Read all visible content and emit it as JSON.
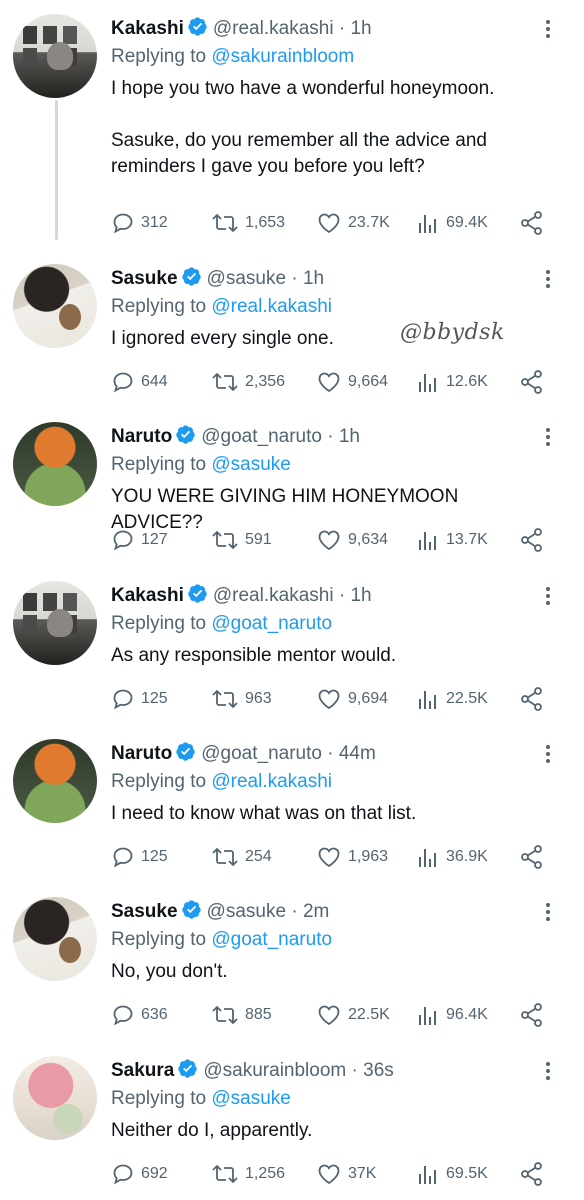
{
  "watermark": "@bbydsk",
  "colors": {
    "link": "#1d9bf0",
    "muted": "#536471",
    "verified": "#1d9bf0"
  },
  "tweets": [
    {
      "name": "Kakashi",
      "handle": "@real.kakashi",
      "sep": "·",
      "time": "1h",
      "replying_label": "Replying to",
      "replying_to": "@sakurainbloom",
      "text": "I hope you two have a wonderful honeymoon.\n\nSasuke, do you remember all the advice and reminders I gave you before you left?",
      "replies": "312",
      "retweets": "1,653",
      "likes": "23.7K",
      "views": "69.4K"
    },
    {
      "name": "Sasuke",
      "handle": "@sasuke",
      "sep": "·",
      "time": "1h",
      "replying_label": "Replying to",
      "replying_to": "@real.kakashi",
      "text": "I ignored every single one.",
      "replies": "644",
      "retweets": "2,356",
      "likes": "9,664",
      "views": "12.6K"
    },
    {
      "name": "Naruto",
      "handle": "@goat_naruto",
      "sep": "·",
      "time": "1h",
      "replying_label": "Replying to",
      "replying_to": "@sasuke",
      "text": "YOU WERE GIVING HIM HONEYMOON ADVICE??",
      "replies": "127",
      "retweets": "591",
      "likes": "9,634",
      "views": "13.7K"
    },
    {
      "name": "Kakashi",
      "handle": "@real.kakashi",
      "sep": "·",
      "time": "1h",
      "replying_label": "Replying to",
      "replying_to": "@goat_naruto",
      "text": "As any responsible mentor would.",
      "replies": "125",
      "retweets": "963",
      "likes": "9,694",
      "views": "22.5K"
    },
    {
      "name": "Naruto",
      "handle": "@goat_naruto",
      "sep": "·",
      "time": "44m",
      "replying_label": "Replying to",
      "replying_to": "@real.kakashi",
      "text": "I need to know what was on that list.",
      "replies": "125",
      "retweets": "254",
      "likes": "1,963",
      "views": "36.9K"
    },
    {
      "name": "Sasuke",
      "handle": "@sasuke",
      "sep": "·",
      "time": "2m",
      "replying_label": "Replying to",
      "replying_to": "@goat_naruto",
      "text": "No, you don't.",
      "replies": "636",
      "retweets": "885",
      "likes": "22.5K",
      "views": "96.4K"
    },
    {
      "name": "Sakura",
      "handle": "@sakurainbloom",
      "sep": "·",
      "time": "36s",
      "replying_label": "Replying to",
      "replying_to": "@sasuke",
      "text": "Neither do I, apparently.",
      "replies": "692",
      "retweets": "1,256",
      "likes": "37K",
      "views": "69.5K"
    }
  ]
}
